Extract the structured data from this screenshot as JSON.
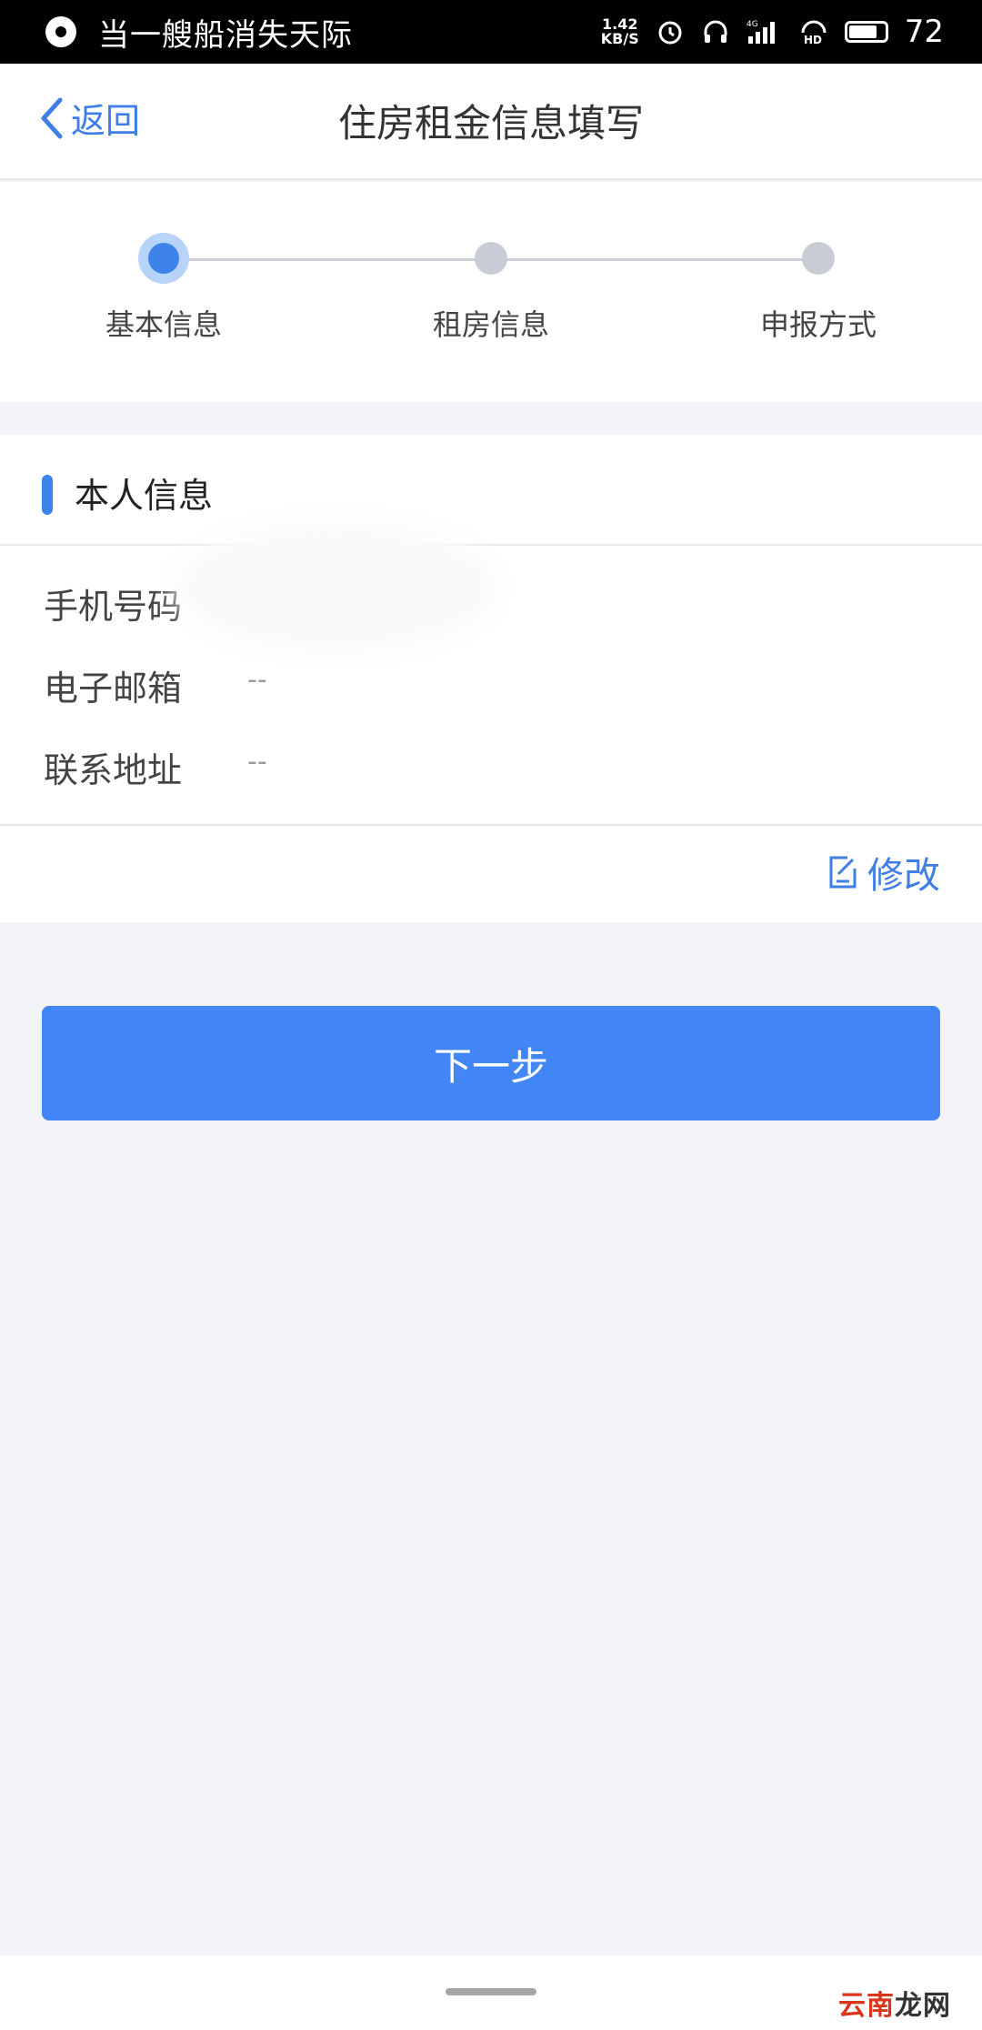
{
  "status_bar": {
    "now_playing": "当一艘船消失天际",
    "net_speed_value": "1.42",
    "net_speed_unit": "KB/S",
    "network": "4G",
    "hd": "HD",
    "battery": "72"
  },
  "nav": {
    "back_label": "返回",
    "title": "住房租金信息填写"
  },
  "steps": [
    {
      "label": "基本信息",
      "active": true
    },
    {
      "label": "租房信息",
      "active": false
    },
    {
      "label": "申报方式",
      "active": false
    }
  ],
  "personal_info": {
    "title": "本人信息",
    "rows": [
      {
        "label": "手机号码",
        "value": ""
      },
      {
        "label": "电子邮箱",
        "value": "--"
      },
      {
        "label": "联系地址",
        "value": "--"
      }
    ],
    "edit_label": "修改"
  },
  "next_button_label": "下一步",
  "watermark": {
    "part1": "云南",
    "part2": "龙网"
  },
  "colors": {
    "accent": "#4285f4",
    "link": "#3f7ee5",
    "background": "#f3f4f8"
  }
}
